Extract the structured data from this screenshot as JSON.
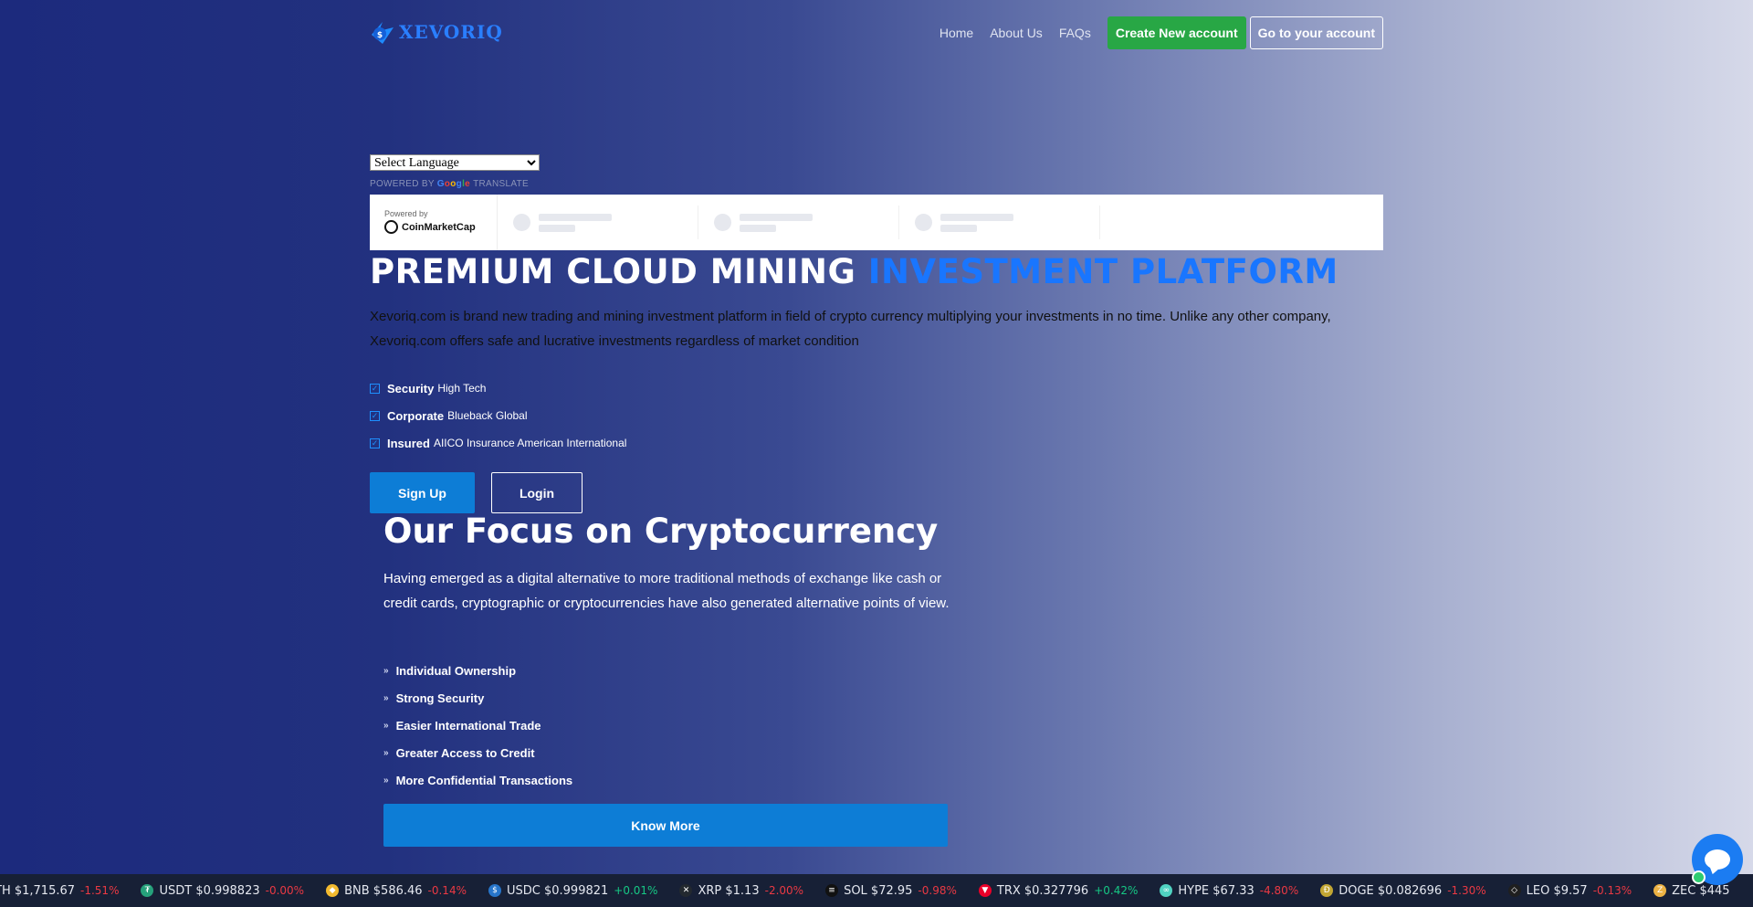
{
  "brand": {
    "name": "XEVORIQ"
  },
  "nav": {
    "links": [
      "Home",
      "About Us",
      "FAQs"
    ],
    "create_account": "Create New account",
    "go_account": "Go to your account"
  },
  "language": {
    "select_label": "Select Language",
    "powered_prefix": "POWERED BY",
    "google": "Google",
    "translate": "TRANSLATE"
  },
  "cmc": {
    "powered": "Powered by",
    "name": "CoinMarketCap"
  },
  "hero": {
    "title_main": "PREMIUM CLOUD MINING ",
    "title_accent": "INVESTMENT PLATFORM",
    "description": "Xevoriq.com is brand new trading and mining investment platform in field of crypto currency multiplying your investments in no time. Unlike any other company, Xevoriq.com offers safe and lucrative investments regardless of market condition",
    "features": [
      {
        "bold": "Security",
        "text": "High Tech"
      },
      {
        "bold": "Corporate",
        "text": "Blueback Global"
      },
      {
        "bold": "Insured",
        "text": "AIICO Insurance American International"
      }
    ],
    "signup": "Sign Up",
    "login": "Login"
  },
  "focus": {
    "title": "Our Focus on Cryptocurrency",
    "description": "Having emerged as a digital alternative to more traditional methods of exchange like cash or credit cards, cryptographic or cryptocurrencies have also generated alternative points of view.",
    "items": [
      "Individual Ownership",
      "Strong Security",
      "Easier International Trade",
      "Greater Access to Credit",
      "More Confidential Transactions"
    ],
    "button": "Know More"
  },
  "ticker": [
    {
      "symbol": "TH",
      "price": "$1,715.67",
      "change": "-1.51%",
      "dir": "neg",
      "color": "",
      "icon": ""
    },
    {
      "symbol": "USDT",
      "price": "$0.998823",
      "change": "-0.00%",
      "dir": "neg",
      "color": "#26a17b",
      "icon": "tether-icon"
    },
    {
      "symbol": "BNB",
      "price": "$586.46",
      "change": "-0.14%",
      "dir": "neg",
      "color": "#f3ba2f",
      "icon": "bnb-icon"
    },
    {
      "symbol": "USDC",
      "price": "$0.999821",
      "change": "+0.01%",
      "dir": "pos",
      "color": "#2775ca",
      "icon": "usdc-icon"
    },
    {
      "symbol": "XRP",
      "price": "$1.13",
      "change": "-2.00%",
      "dir": "neg",
      "color": "#23292f",
      "icon": "xrp-icon"
    },
    {
      "symbol": "SOL",
      "price": "$72.95",
      "change": "-0.98%",
      "dir": "neg",
      "color": "#111111",
      "icon": "solana-icon"
    },
    {
      "symbol": "TRX",
      "price": "$0.327796",
      "change": "+0.42%",
      "dir": "pos",
      "color": "#eb0029",
      "icon": "tron-icon"
    },
    {
      "symbol": "HYPE",
      "price": "$67.33",
      "change": "-4.80%",
      "dir": "neg",
      "color": "#50d2c1",
      "icon": "hype-icon"
    },
    {
      "symbol": "DOGE",
      "price": "$0.082696",
      "change": "-1.30%",
      "dir": "neg",
      "color": "#c2a633",
      "icon": "doge-icon"
    },
    {
      "symbol": "LEO",
      "price": "$9.57",
      "change": "-0.13%",
      "dir": "neg",
      "color": "#1f1f1f",
      "icon": "leo-icon"
    },
    {
      "symbol": "ZEC",
      "price": "$445",
      "change": "",
      "dir": "neg",
      "color": "#ecb244",
      "icon": "zcash-icon"
    }
  ]
}
